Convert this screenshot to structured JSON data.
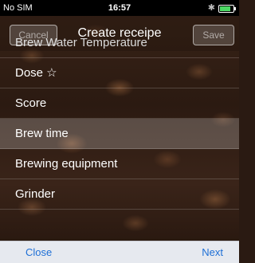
{
  "status_bar": {
    "carrier": "No SIM",
    "time": "16:57",
    "bluetooth_icon": "bluetooth-icon",
    "battery_level": 0.8
  },
  "navbar": {
    "title": "Create receipe",
    "cancel_label": "Cancel",
    "save_label": "Save"
  },
  "list": {
    "items": [
      {
        "label": "Brew Water Temperature",
        "highlighted": false
      },
      {
        "label": "Dose ☆",
        "highlighted": false
      },
      {
        "label": "Score",
        "highlighted": false
      },
      {
        "label": "Brew time",
        "highlighted": true
      },
      {
        "label": "Brewing equipment",
        "highlighted": false
      },
      {
        "label": "Grinder",
        "highlighted": false
      }
    ]
  },
  "toolbar": {
    "close_label": "Close",
    "next_label": "Next",
    "accent_color": "#1e6fd6"
  }
}
